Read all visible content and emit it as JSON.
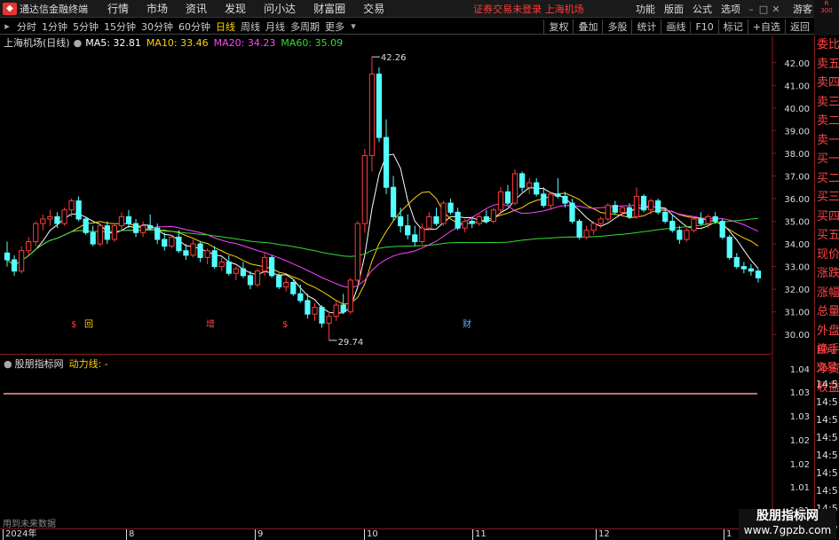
{
  "menubar": {
    "title": "通达信金融终端",
    "items": [
      "行情",
      "市场",
      "资讯",
      "发现",
      "问小达",
      "财富圈",
      "交易"
    ],
    "status": "证券交易未登录  上海机场",
    "right_items": [
      "功能",
      "版面",
      "公式",
      "选项",
      "游客"
    ]
  },
  "toolbar": {
    "periods": [
      "分时",
      "1分钟",
      "5分钟",
      "15分钟",
      "30分钟",
      "60分钟",
      "日线",
      "周线",
      "月线",
      "多周期",
      "更多"
    ],
    "active_period": "日线",
    "buttons": [
      "复权",
      "叠加",
      "多股",
      "统计",
      "画线",
      "F10",
      "标记",
      "+自选",
      "返回"
    ]
  },
  "main_chart": {
    "stock_label": "上海机场(日线)",
    "ma": [
      {
        "label": "MA5: 32.81",
        "color": "#ffffff"
      },
      {
        "label": "MA10: 33.46",
        "color": "#ffd200"
      },
      {
        "label": "MA20: 34.23",
        "color": "#ff44ff"
      },
      {
        "label": "MA60: 35.09",
        "color": "#33dd33"
      }
    ],
    "high_label": "42.26",
    "low_label": "29.74",
    "markers": [
      {
        "text": "$",
        "color": "#ff4444"
      },
      {
        "text": "回",
        "color": "#ffd200"
      },
      {
        "text": "增",
        "color": "#ff4444"
      },
      {
        "text": "$",
        "color": "#ff4444"
      },
      {
        "text": "财",
        "color": "#66aaff"
      }
    ]
  },
  "chart_data": {
    "type": "candlestick",
    "y_axis": [
      "42.00",
      "41.00",
      "40.00",
      "39.00",
      "38.00",
      "37.00",
      "36.00",
      "35.00",
      "34.00",
      "33.00",
      "32.00",
      "31.00",
      "30.00"
    ],
    "ylim": [
      29.5,
      42.5
    ],
    "x_labels": [
      "2024年",
      "8",
      "9",
      "10",
      "11",
      "12",
      "1"
    ],
    "candles": [
      [
        33.6,
        34.1,
        33.0,
        33.3
      ],
      [
        33.3,
        33.5,
        32.6,
        32.8
      ],
      [
        32.8,
        33.9,
        32.7,
        33.7
      ],
      [
        33.7,
        34.3,
        33.5,
        34.1
      ],
      [
        34.1,
        35.0,
        33.9,
        34.9
      ],
      [
        34.9,
        35.3,
        34.6,
        35.1
      ],
      [
        35.1,
        35.5,
        34.8,
        35.2
      ],
      [
        35.2,
        35.4,
        34.7,
        34.9
      ],
      [
        34.9,
        35.6,
        34.8,
        35.5
      ],
      [
        35.5,
        36.0,
        35.2,
        35.9
      ],
      [
        35.9,
        36.1,
        35.0,
        35.1
      ],
      [
        35.1,
        35.2,
        34.4,
        34.5
      ],
      [
        34.5,
        34.8,
        33.9,
        34.0
      ],
      [
        34.0,
        34.9,
        33.9,
        34.8
      ],
      [
        34.8,
        35.0,
        34.0,
        34.2
      ],
      [
        34.2,
        34.9,
        34.1,
        34.8
      ],
      [
        34.8,
        35.4,
        34.6,
        35.2
      ],
      [
        35.2,
        35.5,
        34.7,
        34.9
      ],
      [
        34.9,
        35.1,
        34.3,
        34.5
      ],
      [
        34.5,
        35.0,
        34.3,
        34.8
      ],
      [
        34.8,
        35.3,
        34.6,
        34.7
      ],
      [
        34.7,
        34.9,
        34.0,
        34.2
      ],
      [
        34.2,
        34.5,
        33.7,
        33.9
      ],
      [
        33.9,
        34.4,
        33.8,
        34.3
      ],
      [
        34.3,
        34.6,
        33.6,
        33.7
      ],
      [
        33.7,
        34.0,
        33.3,
        33.5
      ],
      [
        33.5,
        34.2,
        33.4,
        34.0
      ],
      [
        34.0,
        34.1,
        33.2,
        33.4
      ],
      [
        33.4,
        33.8,
        33.1,
        33.7
      ],
      [
        33.7,
        33.9,
        32.9,
        33.0
      ],
      [
        33.0,
        33.4,
        32.8,
        33.2
      ],
      [
        33.2,
        33.5,
        32.6,
        32.7
      ],
      [
        32.7,
        33.0,
        32.4,
        32.9
      ],
      [
        32.9,
        33.2,
        32.5,
        32.6
      ],
      [
        32.6,
        32.8,
        32.0,
        32.2
      ],
      [
        32.2,
        32.9,
        32.1,
        32.8
      ],
      [
        32.8,
        33.6,
        32.6,
        33.4
      ],
      [
        33.4,
        33.5,
        32.5,
        32.6
      ],
      [
        32.6,
        32.7,
        32.0,
        32.1
      ],
      [
        32.1,
        32.5,
        31.9,
        32.3
      ],
      [
        32.3,
        32.4,
        31.7,
        31.8
      ],
      [
        31.8,
        32.2,
        31.4,
        31.5
      ],
      [
        31.5,
        31.8,
        30.7,
        30.9
      ],
      [
        30.9,
        31.4,
        30.6,
        31.2
      ],
      [
        31.2,
        31.3,
        30.3,
        30.5
      ],
      [
        30.5,
        31.0,
        29.74,
        30.8
      ],
      [
        30.8,
        31.5,
        30.6,
        31.3
      ],
      [
        31.3,
        31.8,
        30.9,
        31.0
      ],
      [
        31.0,
        32.5,
        30.9,
        32.4
      ],
      [
        32.4,
        35.0,
        32.3,
        34.9
      ],
      [
        34.9,
        38.2,
        34.5,
        37.9
      ],
      [
        37.9,
        42.26,
        37.2,
        41.5
      ],
      [
        41.5,
        41.8,
        38.5,
        38.7
      ],
      [
        38.7,
        39.5,
        36.2,
        36.5
      ],
      [
        36.5,
        37.0,
        35.0,
        35.2
      ],
      [
        35.2,
        35.6,
        34.5,
        34.8
      ],
      [
        34.8,
        35.3,
        34.2,
        34.4
      ],
      [
        34.4,
        34.8,
        33.9,
        34.1
      ],
      [
        34.1,
        34.9,
        34.0,
        34.7
      ],
      [
        34.7,
        35.4,
        34.6,
        35.2
      ],
      [
        35.2,
        35.6,
        34.8,
        34.9
      ],
      [
        34.9,
        35.9,
        34.8,
        35.8
      ],
      [
        35.8,
        36.0,
        35.3,
        35.4
      ],
      [
        35.4,
        35.6,
        34.6,
        34.7
      ],
      [
        34.7,
        35.1,
        34.5,
        35.0
      ],
      [
        35.0,
        35.2,
        34.7,
        34.9
      ],
      [
        34.9,
        35.3,
        34.8,
        35.2
      ],
      [
        35.2,
        35.5,
        34.9,
        35.0
      ],
      [
        35.0,
        35.6,
        34.9,
        35.5
      ],
      [
        35.5,
        36.5,
        35.4,
        36.3
      ],
      [
        36.3,
        36.6,
        35.7,
        35.8
      ],
      [
        35.8,
        37.3,
        35.7,
        37.1
      ],
      [
        37.1,
        37.2,
        36.3,
        36.5
      ],
      [
        36.5,
        36.9,
        36.2,
        36.7
      ],
      [
        36.7,
        36.9,
        36.1,
        36.2
      ],
      [
        36.2,
        36.5,
        35.6,
        35.7
      ],
      [
        35.7,
        36.3,
        35.5,
        36.2
      ],
      [
        36.2,
        36.9,
        36.0,
        36.1
      ],
      [
        36.1,
        36.3,
        35.6,
        35.8
      ],
      [
        35.8,
        36.0,
        34.9,
        35.0
      ],
      [
        35.0,
        35.1,
        34.2,
        34.3
      ],
      [
        34.3,
        34.8,
        34.2,
        34.6
      ],
      [
        34.6,
        35.0,
        34.4,
        34.9
      ],
      [
        34.9,
        35.2,
        34.7,
        35.1
      ],
      [
        35.1,
        35.8,
        35.0,
        35.7
      ],
      [
        35.7,
        35.9,
        35.3,
        35.4
      ],
      [
        35.4,
        35.7,
        35.2,
        35.6
      ],
      [
        35.6,
        35.8,
        35.1,
        35.2
      ],
      [
        35.2,
        36.5,
        35.1,
        36.1
      ],
      [
        36.1,
        36.2,
        35.4,
        35.5
      ],
      [
        35.5,
        36.0,
        35.3,
        35.9
      ],
      [
        35.9,
        36.0,
        35.3,
        35.4
      ],
      [
        35.4,
        35.6,
        34.9,
        35.0
      ],
      [
        35.0,
        35.3,
        34.5,
        34.6
      ],
      [
        34.6,
        34.8,
        34.0,
        34.2
      ],
      [
        34.2,
        34.7,
        34.1,
        34.6
      ],
      [
        34.6,
        35.2,
        34.5,
        35.1
      ],
      [
        35.1,
        35.4,
        34.8,
        34.9
      ],
      [
        34.9,
        35.3,
        34.7,
        35.2
      ],
      [
        35.2,
        35.4,
        34.9,
        35.0
      ],
      [
        35.0,
        35.1,
        34.2,
        34.3
      ],
      [
        34.3,
        34.4,
        33.3,
        33.4
      ],
      [
        33.4,
        33.6,
        32.9,
        33.0
      ],
      [
        33.0,
        33.2,
        32.7,
        32.9
      ],
      [
        32.9,
        33.1,
        32.6,
        32.8
      ],
      [
        32.8,
        32.9,
        32.3,
        32.5
      ]
    ]
  },
  "sub_chart": {
    "name": "股朋指标网",
    "line_label": "动力线: -",
    "y_axis": [
      "1.04",
      "1.03",
      "1.03",
      "1.02",
      "1.02",
      "1.01",
      "1.01"
    ]
  },
  "side_panel": {
    "corner": [
      "R",
      "300"
    ],
    "items": [
      "委比",
      "卖五",
      "卖四",
      "卖三",
      "卖二",
      "卖一",
      "买一",
      "买二",
      "买三",
      "买四",
      "买五",
      "现价",
      "涨跌",
      "涨幅",
      "总量",
      "外盘",
      "换手",
      "净资",
      "收益"
    ],
    "sub_items": [
      "自动",
      "交易"
    ],
    "times": [
      "14:5",
      "14:5",
      "14:5",
      "14:5",
      "14:5",
      "14:5",
      "14:5",
      "14:5",
      "14:5"
    ]
  },
  "bottom_note": "用到未来数据",
  "watermark": {
    "line1": "股朋指标网",
    "line2": "www.7gpzb.com"
  },
  "colors": {
    "up": "#ff3b3b",
    "down": "#54ffff",
    "axis_border": "#8b1a1a"
  }
}
